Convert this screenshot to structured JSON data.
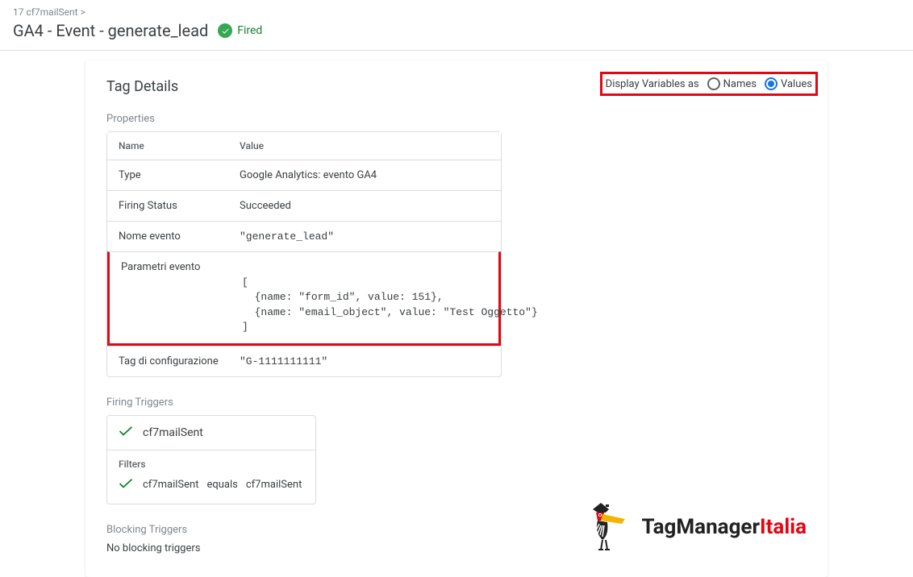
{
  "breadcrumb": "17 cf7mailSent >",
  "pageTitle": "GA4 - Event - generate_lead",
  "firedLabel": "Fired",
  "displayVariables": {
    "label": "Display Variables as",
    "names": "Names",
    "values": "Values"
  },
  "card": {
    "title": "Tag Details",
    "propertiesLabel": "Properties",
    "propsHeader": {
      "name": "Name",
      "value": "Value"
    },
    "rows": {
      "type": {
        "name": "Type",
        "value": "Google Analytics: evento GA4"
      },
      "firing": {
        "name": "Firing Status",
        "value": "Succeeded"
      },
      "eventName": {
        "name": "Nome evento",
        "value": "\"generate_lead\""
      },
      "eventParams": {
        "name": "Parametri evento",
        "line1": "[",
        "line2pre": "  {name: ",
        "line2a": "\"form_id\"",
        "line2mid": ", value: 151},",
        "line3pre": "  {name: ",
        "line3a": "\"email_object\"",
        "line3mid": ", value: ",
        "line3b": "\"Test Oggetto\"",
        "line3end": "}",
        "line4": "]"
      },
      "configTag": {
        "name": "Tag di configurazione",
        "value": "\"G-1111111111\""
      }
    },
    "firingTriggers": {
      "label": "Firing Triggers",
      "triggerName": "cf7mailSent",
      "filtersLabel": "Filters",
      "filterLeft": "cf7mailSent",
      "filterOp": "equals",
      "filterRight": "cf7mailSent"
    },
    "blocking": {
      "label": "Blocking Triggers",
      "text": "No blocking triggers"
    }
  },
  "logo": {
    "part1": "TagManager",
    "part2": "Italia"
  }
}
